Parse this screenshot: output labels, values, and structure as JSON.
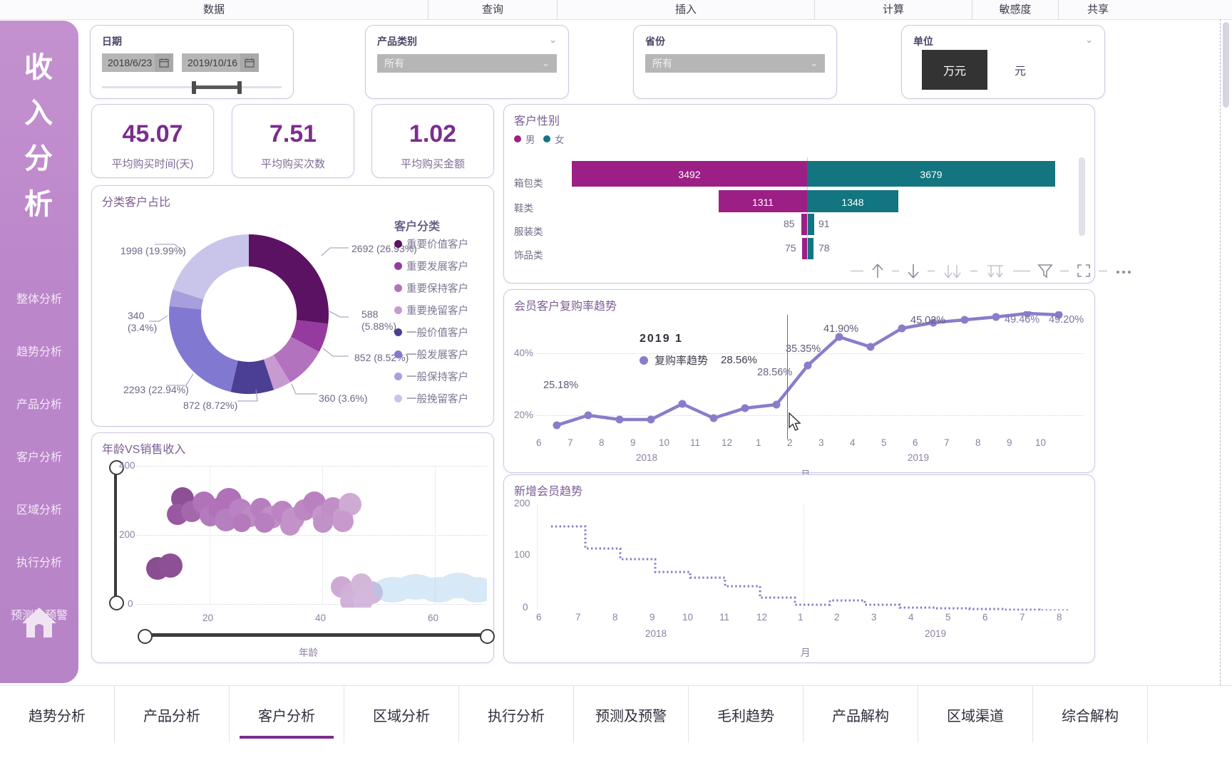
{
  "ribbon": {
    "tabs": [
      {
        "label": "数据",
        "w": "rb-a"
      },
      {
        "label": "查询",
        "w": "rb-b"
      },
      {
        "label": "插入",
        "w": "rb-c"
      },
      {
        "label": "计算",
        "w": "rb-d"
      },
      {
        "label": "敏感度",
        "w": "rb-e"
      },
      {
        "label": "共享",
        "w": "rb-f"
      }
    ]
  },
  "rail": {
    "title": "收入分析",
    "title_chars": [
      "收",
      "入",
      "分",
      "析"
    ],
    "items": [
      {
        "label": "整体分析"
      },
      {
        "label": "趋势分析"
      },
      {
        "label": "产品分析"
      },
      {
        "label": "客户分析"
      },
      {
        "label": "区域分析"
      },
      {
        "label": "执行分析"
      },
      {
        "label": "预测及预警"
      }
    ],
    "home_icon": "home-icon"
  },
  "filters": {
    "date": {
      "label": "日期",
      "start": "2018/6/23",
      "end": "2019/10/16",
      "icon": "calendar-icon"
    },
    "category": {
      "label": "产品类别",
      "value": "所有",
      "placeholder": "所有",
      "icon": "chevron-down-icon"
    },
    "province": {
      "label": "省份",
      "value": "所有",
      "placeholder": "所有",
      "icon": "chevron-down-icon"
    },
    "unit": {
      "label": "单位",
      "options": [
        "万元",
        "元"
      ],
      "selected": "万元",
      "icon": "chevron-down-icon"
    }
  },
  "kpis": [
    {
      "value": "45.07",
      "label": "平均购买时间(天)"
    },
    {
      "value": "7.51",
      "label": "平均购买次数"
    },
    {
      "value": "1.02",
      "label": "平均购买金额"
    }
  ],
  "colors": {
    "accent": "#7b2d8e",
    "rail": "#bb86ca",
    "male": "#9c1f86",
    "female": "#12757f",
    "line": "#8a7ccb"
  },
  "donut": {
    "title": "分类客户占比",
    "legend_title": "客户分类",
    "chart_data": {
      "type": "pie",
      "title": "分类客户占比",
      "legend_position": "right",
      "categories": [
        "重要价值客户",
        "重要发展客户",
        "重要保持客户",
        "重要挽留客户",
        "一般价值客户",
        "一般发展客户",
        "一般保持客户",
        "一般挽留客户"
      ],
      "values": [
        2692,
        588,
        852,
        360,
        872,
        2293,
        340,
        1998
      ],
      "percents": [
        "26.93%",
        "5.88%",
        "8.52%",
        "3.6%",
        "8.72%",
        "22.94%",
        "3.4%",
        "19.99%"
      ],
      "colors": [
        "#5c1263",
        "#953a9e",
        "#b272bd",
        "#c79bd1",
        "#4b3f93",
        "#8179d1",
        "#a79fdd",
        "#c9c4ea"
      ],
      "labels": [
        "2692 (26.93%)",
        "588\n(5.88%)",
        "852 (8.52%)",
        "360 (3.6%)",
        "872 (8.72%)",
        "2293 (22.94%)",
        "340\n(3.4%)",
        "1998 (19.99%)"
      ]
    }
  },
  "gender": {
    "title": "客户性别",
    "legend": [
      {
        "label": "男",
        "color": "#9c1f86"
      },
      {
        "label": "女",
        "color": "#12757f"
      }
    ],
    "chart_data": {
      "type": "bar",
      "orientation": "diverging-horizontal",
      "title": "客户性别",
      "categories": [
        "箱包类",
        "鞋类",
        "服装类",
        "饰品类"
      ],
      "series": [
        {
          "name": "男",
          "values": [
            3492,
            1311,
            85,
            75
          ]
        },
        {
          "name": "女",
          "values": [
            3679,
            1348,
            91,
            78
          ]
        }
      ]
    },
    "toolbar_icons": [
      "sort-up-icon",
      "sort-down-icon",
      "drill-down-icon",
      "drill-up-icon",
      "filter-icon",
      "expand-icon",
      "more-icon"
    ]
  },
  "repurchase": {
    "title": "会员客户复购率趋势",
    "tooltip": {
      "header": "2019 1",
      "series": "复购率趋势",
      "value": "28.56%"
    },
    "chart_data": {
      "type": "line",
      "title": "会员客户复购率趋势",
      "xlabel": "月",
      "ylabel": "",
      "ylim": [
        18,
        52
      ],
      "yticks": [
        "20%",
        "40%"
      ],
      "grid": true,
      "years": [
        "2018",
        "2019"
      ],
      "x": [
        "6",
        "7",
        "8",
        "9",
        "10",
        "11",
        "12",
        "1",
        "2",
        "3",
        "4",
        "5",
        "6",
        "7",
        "8",
        "9",
        "10"
      ],
      "values": [
        25.18,
        26.6,
        26.0,
        26.0,
        28.2,
        26.4,
        27.6,
        28.56,
        35.35,
        41.9,
        39.9,
        43.5,
        45.02,
        46.2,
        47.6,
        49.46,
        49.2
      ],
      "point_labels": [
        "25.18%",
        "",
        "",
        "",
        "",
        "",
        "",
        "28.56%",
        "35.35%",
        "41.90%",
        "",
        "",
        "45.02%",
        "",
        "",
        "49.46%",
        "49.20%"
      ]
    }
  },
  "newmembers": {
    "title": "新增会员趋势",
    "chart_data": {
      "type": "line",
      "style": "step-dotted",
      "title": "新增会员趋势",
      "xlabel": "月",
      "ylim": [
        0,
        200
      ],
      "yticks": [
        "0",
        "100",
        "200"
      ],
      "years": [
        "2018",
        "2019"
      ],
      "x": [
        "6",
        "7",
        "8",
        "9",
        "10",
        "11",
        "12",
        "1",
        "2",
        "3",
        "4",
        "5",
        "6",
        "7",
        "8"
      ],
      "values": [
        157,
        157,
        116,
        116,
        96,
        72,
        62,
        40,
        22,
        28,
        22,
        16,
        14,
        12,
        10
      ]
    }
  },
  "scatter": {
    "title": "年龄VS销售收入",
    "chart_data": {
      "type": "scatter",
      "title": "年龄VS销售收入",
      "xlabel": "年龄",
      "ylabel": "",
      "xticks": [
        "20",
        "40",
        "60"
      ],
      "yticks": [
        "0",
        "200",
        "400"
      ],
      "xlim": [
        10,
        70
      ],
      "ylim": [
        0,
        400
      ],
      "grid": true
    }
  },
  "sheets": [
    {
      "label": "趋势分析",
      "active": false
    },
    {
      "label": "产品分析",
      "active": false
    },
    {
      "label": "客户分析",
      "active": true
    },
    {
      "label": "区域分析",
      "active": false
    },
    {
      "label": "执行分析",
      "active": false
    },
    {
      "label": "预测及预警",
      "active": false
    },
    {
      "label": "毛利趋势",
      "active": false
    },
    {
      "label": "产品解构",
      "active": false
    },
    {
      "label": "区域渠道",
      "active": false
    },
    {
      "label": "综合解构",
      "active": false
    }
  ]
}
